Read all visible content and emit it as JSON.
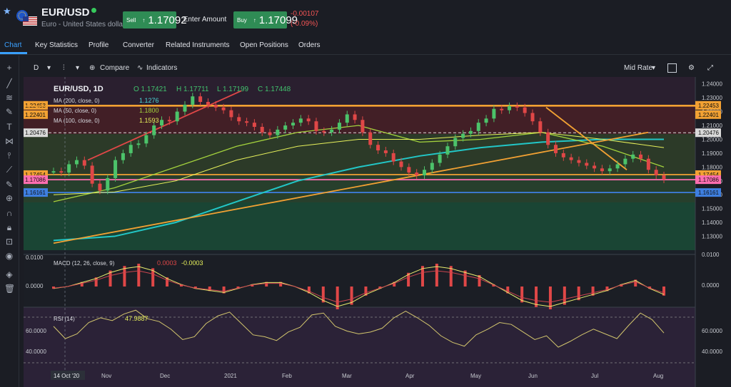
{
  "header": {
    "title": "EUR/USD",
    "subtitle": "Euro - United States dollar",
    "sell_label": "Sell",
    "sell_price": "1.17092",
    "amount_label": "Enter Amount",
    "buy_label": "Buy",
    "buy_price": "1.17099",
    "change": "-0.00107",
    "change_pct": "(-0.09%)",
    "status_color": "#36c95c"
  },
  "tabs": [
    {
      "label": "Chart"
    },
    {
      "label": "Key Statistics"
    },
    {
      "label": "Profile"
    },
    {
      "label": "Converter"
    },
    {
      "label": "Related Instruments"
    },
    {
      "label": "Open Positions"
    },
    {
      "label": "Orders"
    }
  ],
  "toolbar": {
    "interval": "D",
    "compare": "Compare",
    "indicators": "Indicators",
    "rate": "Mid Rate"
  },
  "chart": {
    "legend": "EUR/USD, 1D",
    "open": "O 1.17421",
    "high": "H 1.17711",
    "low": "L 1.17199",
    "close": "C 1.17448",
    "ma200": "MA (200, close, 0)",
    "ma200_value": "1.1276",
    "ma50": "MA (50, close, 0)",
    "ma50_value": "1.1800",
    "ma100": "MA (100, close, 0)",
    "ma100_value": "1.1593",
    "macd": "MACD (12, 26, close, 9)",
    "macd_value": "0.0003",
    "macd_value2": "-0.0003",
    "rsi": "RSI (14)",
    "rsi_value": "47.9887",
    "price_ticks": [
      "1.24000",
      "1.23000",
      "1.22000",
      "1.21000",
      "1.20000",
      "1.19000",
      "1.18000",
      "1.17000",
      "1.16000",
      "1.15000",
      "1.14000",
      "1.13000"
    ],
    "left_levels": [
      "1.22453",
      "1.22401",
      "1.20476",
      "1.17454",
      "1.17086",
      "1.16161"
    ],
    "right_levels": [
      "1.22453",
      "1.22401",
      "1.20476",
      "1.17454",
      "1.17086",
      "1.16161"
    ],
    "macd_ticks": [
      "0.0100",
      "0.0000"
    ],
    "rsi_ticks": [
      "60.0000",
      "40.0000"
    ],
    "x_labels": [
      "14 Oct '20",
      "Nov",
      "Dec",
      "2021",
      "Feb",
      "Mar",
      "Apr",
      "May",
      "Jun",
      "Jul",
      "Aug"
    ],
    "colors": {
      "candle_up": "#4cc36a",
      "candle_down": "#e04747",
      "ma200": "#22c7c7",
      "ma50": "#a4d33d",
      "ma100": "#e7f15b",
      "orange": "#f2a133",
      "blue": "#3e7fe0"
    }
  },
  "chart_data": {
    "type": "line",
    "title": "EUR/USD, 1D",
    "xlabel": "",
    "ylabel": "",
    "x": [
      "14 Oct '20",
      "Nov",
      "Dec",
      "2021",
      "Feb",
      "Mar",
      "Apr",
      "May",
      "Jun",
      "Jul",
      "Aug"
    ],
    "series": [
      {
        "name": "EUR/USD",
        "values": [
          1.174,
          1.165,
          1.195,
          1.22,
          1.205,
          1.205,
          1.185,
          1.21,
          1.22,
          1.182,
          1.171
        ]
      },
      {
        "name": "MA (200, close, 0)",
        "values": [
          1.127,
          1.13,
          1.14,
          1.155,
          1.17,
          1.18,
          1.188,
          1.194,
          1.198,
          1.2,
          1.2
        ]
      },
      {
        "name": "MA (50, close, 0)",
        "values": [
          1.155,
          1.165,
          1.18,
          1.195,
          1.205,
          1.21,
          1.198,
          1.2,
          1.205,
          1.195,
          1.18
        ]
      },
      {
        "name": "MA (100, close, 0)",
        "values": [
          1.16,
          1.162,
          1.17,
          1.185,
          1.195,
          1.2,
          1.2,
          1.203,
          1.205,
          1.2,
          1.194
        ]
      }
    ],
    "ylim": [
      1.12,
      1.245
    ]
  }
}
